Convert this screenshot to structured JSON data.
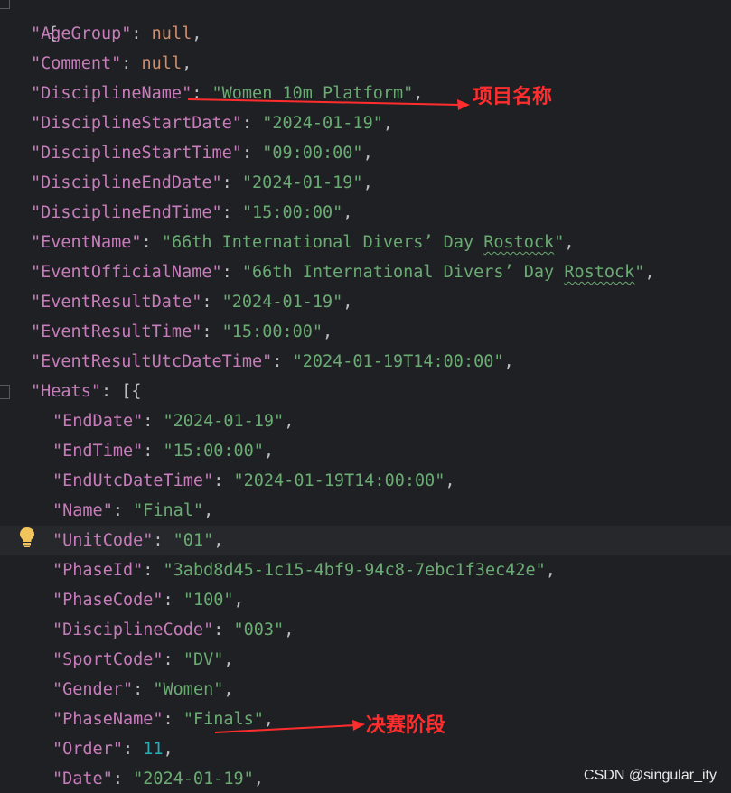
{
  "code": {
    "open_brace": "{",
    "l1": {
      "key": "\"AgeGroup\"",
      "sep": ": ",
      "val": "null",
      "end": ","
    },
    "l2": {
      "key": "\"Comment\"",
      "sep": ": ",
      "val": "null",
      "end": ","
    },
    "l3": {
      "key": "\"DisciplineName\"",
      "sep": ": ",
      "val": "\"Women 10m Platform\"",
      "end": ","
    },
    "l4": {
      "key": "\"DisciplineStartDate\"",
      "sep": ": ",
      "val": "\"2024-01-19\"",
      "end": ","
    },
    "l5": {
      "key": "\"DisciplineStartTime\"",
      "sep": ": ",
      "val": "\"09:00:00\"",
      "end": ","
    },
    "l6": {
      "key": "\"DisciplineEndDate\"",
      "sep": ": ",
      "val": "\"2024-01-19\"",
      "end": ","
    },
    "l7": {
      "key": "\"DisciplineEndTime\"",
      "sep": ": ",
      "val": "\"15:00:00\"",
      "end": ","
    },
    "l8": {
      "key": "\"EventName\"",
      "sep": ": ",
      "val_a": "\"66th International Divers’ Day ",
      "val_b": "Rostock",
      "val_c": "\"",
      "end": ","
    },
    "l9": {
      "key": "\"EventOfficialName\"",
      "sep": ": ",
      "val_a": "\"66th International Divers’ Day ",
      "val_b": "Rostock",
      "val_c": "\"",
      "end": ","
    },
    "l10": {
      "key": "\"EventResultDate\"",
      "sep": ": ",
      "val": "\"2024-01-19\"",
      "end": ","
    },
    "l11": {
      "key": "\"EventResultTime\"",
      "sep": ": ",
      "val": "\"15:00:00\"",
      "end": ","
    },
    "l12": {
      "key": "\"EventResultUtcDateTime\"",
      "sep": ": ",
      "val": "\"2024-01-19T14:00:00\"",
      "end": ","
    },
    "l13": {
      "key": "\"Heats\"",
      "sep": ": ",
      "val": "[{",
      "end": ""
    },
    "l14": {
      "key": "\"EndDate\"",
      "sep": ": ",
      "val": "\"2024-01-19\"",
      "end": ","
    },
    "l15": {
      "key": "\"EndTime\"",
      "sep": ": ",
      "val": "\"15:00:00\"",
      "end": ","
    },
    "l16": {
      "key": "\"EndUtcDateTime\"",
      "sep": ": ",
      "val": "\"2024-01-19T14:00:00\"",
      "end": ","
    },
    "l17": {
      "key": "\"Name\"",
      "sep": ": ",
      "val": "\"Final\"",
      "end": ","
    },
    "l18": {
      "key": "\"UnitCode\"",
      "sep": ": ",
      "val": "\"01\"",
      "end": ","
    },
    "l19": {
      "key": "\"PhaseId\"",
      "sep": ": ",
      "val": "\"3abd8d45-1c15-4bf9-94c8-7ebc1f3ec42e\"",
      "end": ","
    },
    "l20": {
      "key": "\"PhaseCode\"",
      "sep": ": ",
      "val": "\"100\"",
      "end": ","
    },
    "l21": {
      "key": "\"DisciplineCode\"",
      "sep": ": ",
      "val": "\"003\"",
      "end": ","
    },
    "l22": {
      "key": "\"SportCode\"",
      "sep": ": ",
      "val": "\"DV\"",
      "end": ","
    },
    "l23": {
      "key": "\"Gender\"",
      "sep": ": ",
      "val": "\"Women\"",
      "end": ","
    },
    "l24": {
      "key": "\"PhaseName\"",
      "sep": ": ",
      "val": "\"Finals\"",
      "end": ","
    },
    "l25": {
      "key": "\"Order\"",
      "sep": ": ",
      "val": "11",
      "end": ","
    },
    "l26": {
      "key": "\"Date\"",
      "sep": ": ",
      "val": "\"2024-01-19\"",
      "end": ","
    }
  },
  "annotations": {
    "discipline_label": "项目名称",
    "phase_label": "决赛阶段"
  },
  "watermark": "CSDN @singular_ity",
  "colors": {
    "key": "#c77dbb",
    "string": "#6aab73",
    "keyword": "#cf8e6d",
    "number": "#2aacb8",
    "annotation": "#ff2d2d"
  },
  "icons": [
    "intention-bulb-icon",
    "fold-marker-icon"
  ]
}
